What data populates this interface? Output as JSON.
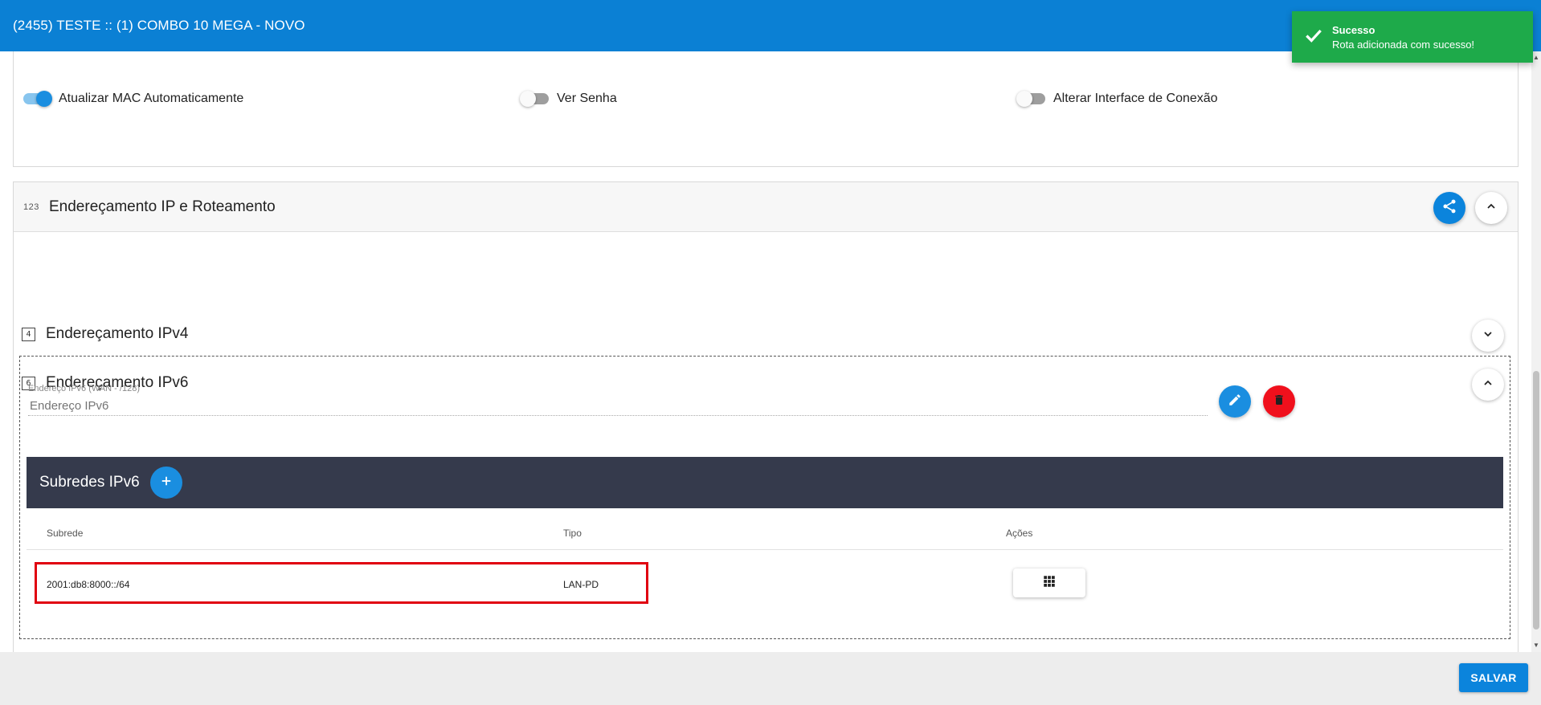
{
  "header": {
    "title": "(2455) TESTE :: (1) COMBO 10 MEGA - NOVO"
  },
  "toggles": [
    {
      "label": "Atualizar MAC Automaticamente",
      "checked": true
    },
    {
      "label": "Ver Senha",
      "checked": false
    },
    {
      "label": "Alterar Interface de Conexão",
      "checked": false
    }
  ],
  "section": {
    "icon_text": "123",
    "title": "Endereçamento IP e Roteamento",
    "ipv4": {
      "icon_text": "4",
      "title": "Endereçamento IPv4"
    },
    "ipv6": {
      "icon_text": "6",
      "title": "Endereçamento IPv6"
    }
  },
  "ipv6_form": {
    "field_label": "Endereço IPv6 (WAN - /128)",
    "field_value": "",
    "field_placeholder": "Endereço IPv6"
  },
  "subnets": {
    "title": "Subredes IPv6",
    "columns": [
      "Subrede",
      "Tipo",
      "Ações"
    ],
    "rows": [
      {
        "subrede": "2001:db8:8000::/64",
        "tipo": "LAN-PD"
      }
    ]
  },
  "footer": {
    "save_label": "SALVAR"
  },
  "toast": {
    "title": "Sucesso",
    "message": "Rota adicionada com sucesso!"
  },
  "colors": {
    "primary": "#0b80d4",
    "success": "#1eaa4a",
    "danger": "#f0101c",
    "subnet_bar": "#353a4c",
    "highlight": "#e00010"
  },
  "icons": {
    "share": "share-icon",
    "collapse": "chevron-up-icon",
    "expand": "chevron-down-icon",
    "edit": "pencil-icon",
    "delete": "trash-icon",
    "add": "plus-icon",
    "actions": "grid-icon",
    "toast": "check-icon"
  }
}
